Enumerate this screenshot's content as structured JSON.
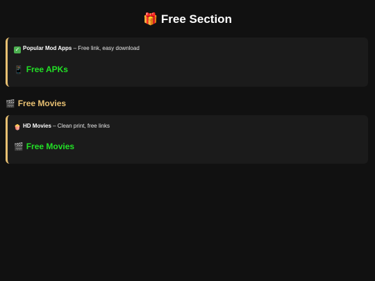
{
  "page": {
    "title": "Free Section",
    "title_icon": "gift-icon",
    "title_icon_glyph": "🎁"
  },
  "cards": [
    {
      "icon": "check-mark-icon",
      "icon_glyph": "✓",
      "name": "Popular Mod Apps",
      "description": " – Free link, easy download",
      "link_icon": "mobile-phone-icon",
      "link_icon_glyph": "📱",
      "link_label": "Free APKs"
    },
    {
      "icon": "popcorn-icon",
      "icon_glyph": "🍿",
      "name": "HD Movies",
      "description": " – Clean print, free links",
      "link_icon": "clapperboard-icon",
      "link_icon_glyph": "🎬",
      "link_label": "Free Movies"
    }
  ],
  "section": {
    "heading": "Free Movies",
    "heading_icon": "clapperboard-icon",
    "heading_icon_glyph": "🎬"
  },
  "colors": {
    "background": "#111111",
    "card_background": "#1b1b1b",
    "accent_border": "#e8c072",
    "link_green": "#22e026",
    "heading_gold": "#e8c072"
  }
}
